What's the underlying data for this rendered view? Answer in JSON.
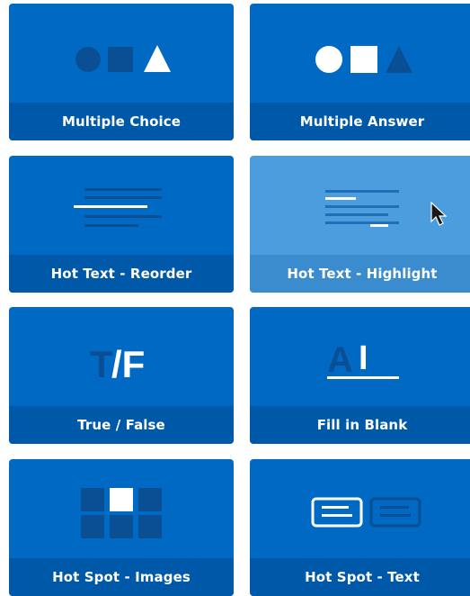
{
  "tiles": [
    {
      "label": "Multiple Choice",
      "icon": "shapes-triangle-selected-icon"
    },
    {
      "label": "Multiple Answer",
      "icon": "shapes-circle-square-selected-icon"
    },
    {
      "label": "Hot Text - Reorder",
      "icon": "text-reorder-icon"
    },
    {
      "label": "Hot Text - Highlight",
      "icon": "text-highlight-icon",
      "state": "hover"
    },
    {
      "label": "True / False",
      "icon": "true-false-icon",
      "glyph_t": "T",
      "glyph_f": "/F"
    },
    {
      "label": "Fill in Blank",
      "icon": "fill-blank-icon",
      "glyph": "A",
      "cursor_glyph": "I"
    },
    {
      "label": "Hot Spot - Images",
      "icon": "image-grid-icon"
    },
    {
      "label": "Hot Spot - Text",
      "icon": "text-boxes-icon"
    }
  ],
  "colors": {
    "tile": "#0069c4",
    "tile_label_bar": "#0059a8",
    "tile_hover": "#4b9ddd",
    "tile_hover_label_bar": "#3a8ccf",
    "icon_muted": "#0a4f94",
    "icon_active": "#ffffff"
  }
}
